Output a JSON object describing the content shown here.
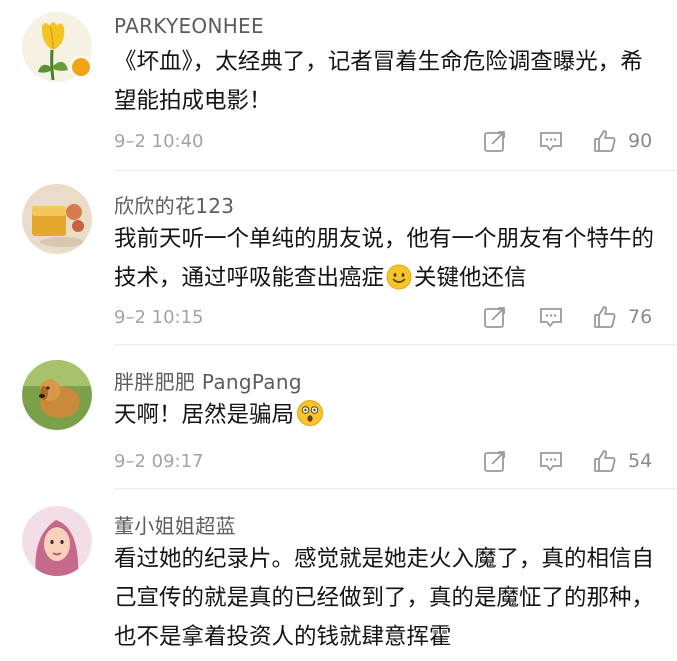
{
  "comments": [
    {
      "username": "PARKYEONHEE",
      "text": "《坏血》，太经典了，记者冒着生命危险调查曝光，希望能拍成电影！",
      "time": "9–2 10:40",
      "likes": "90",
      "verified": true
    },
    {
      "username": "欣欣的花123",
      "text_before_emoji": "我前天听一个单纯的朋友说，他有一个朋友有个特牛的技术，通过呼吸能查出癌症",
      "emoji": "smile-emoji",
      "text_after_emoji": "关键他还信",
      "time": "9–2 10:15",
      "likes": "76"
    },
    {
      "username": "胖胖肥肥 PangPang",
      "text_before_emoji": "天啊！居然是骗局",
      "emoji": "shocked-emoji",
      "time": "9–2 09:17",
      "likes": "54"
    },
    {
      "username": "董小姐姐超蓝",
      "text": "看过她的纪录片。感觉就是她走火入魔了，真的相信自己宣传的就是真的已经做到了，真的是魔怔了的那种，也不是拿着投资人的钱就肆意挥霍"
    }
  ],
  "colors": {
    "verified_badge": "#f2a31a",
    "icon_gray": "#9a9a9a"
  },
  "icons": {
    "repost": "share-edit-icon",
    "reply": "comment-icon",
    "like": "thumbs-up-icon"
  }
}
